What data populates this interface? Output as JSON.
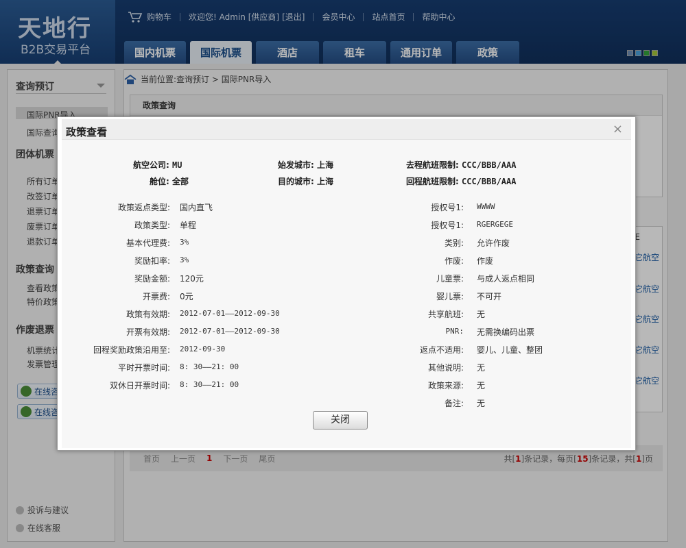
{
  "header": {
    "logo_main": "天地行",
    "logo_sub": "B2B交易平台",
    "top_links": [
      "购物车",
      "欢迎您! Admin [供应商]",
      "[退出]",
      "会员中心",
      "站点首页",
      "帮助中心"
    ],
    "tabs": [
      "国内机票",
      "国际机票",
      "酒店",
      "租车",
      "通用订单",
      "政策"
    ],
    "active_tab": "国际机票",
    "skin_colors": [
      "#6f8fb8",
      "#4aa3e0",
      "#34a53c",
      "#a6c83a"
    ]
  },
  "sidebar": {
    "section1": {
      "title": "查询预订",
      "items": [
        "国际PNR导入",
        "国际查询"
      ]
    },
    "section2": {
      "title": "团体机票",
      "items": [
        "所有订单",
        "改签订单",
        "退票订单",
        "废票订单",
        "退款订单"
      ]
    },
    "section3": {
      "title": "政策查询",
      "items": [
        "查看政策",
        "特价政策"
      ]
    },
    "section4": {
      "title": "作废退票",
      "items": [
        "机票统计",
        "发票管理"
      ]
    },
    "online_buttons": [
      "在线咨询",
      "在线咨询"
    ],
    "bottom": [
      "投诉与建议",
      "在线客服"
    ]
  },
  "breadcrumb": {
    "prefix": "当前位置:",
    "path": "查询预订 > 国际PNR导入"
  },
  "panel1": {
    "title": "政策查询"
  },
  "panel2": {
    "header_fragment": "E",
    "links": [
      "它航空",
      "它航空",
      "它航空",
      "它航空",
      "它航空"
    ]
  },
  "pager": {
    "first": "首页",
    "prev": "上一页",
    "current": "1",
    "next": "下一页",
    "last": "尾页",
    "info_a": "共[",
    "total": "1",
    "info_b": "]条记录，每页[",
    "per_page": "15",
    "info_c": "]条记录，共[",
    "pages": "1",
    "info_d": "]页"
  },
  "modal": {
    "title": "政策查看",
    "close_icon": "×",
    "header_fields": [
      {
        "label": "航空公司:",
        "value": "MU"
      },
      {
        "label": "舱位:",
        "value": "全部"
      },
      {
        "label": "始发城市:",
        "value": "上海"
      },
      {
        "label": "目的城市:",
        "value": "上海"
      },
      {
        "label": "去程航班限制:",
        "value": "CCC/BBB/AAA"
      },
      {
        "label": "回程航班限制:",
        "value": "CCC/BBB/AAA"
      }
    ],
    "left_fields": [
      {
        "label": "政策返点类型:",
        "value": "国内直飞"
      },
      {
        "label": "政策类型:",
        "value": "单程"
      },
      {
        "label": "基本代理费:",
        "value": "3%"
      },
      {
        "label": "奖励扣率:",
        "value": "3%"
      },
      {
        "label": "奖励金额:",
        "value": "120元"
      },
      {
        "label": "开票费:",
        "value": "0元"
      },
      {
        "label": "政策有效期:",
        "value": "2012-07-01——2012-09-30"
      },
      {
        "label": "开票有效期:",
        "value": "2012-07-01——2012-09-30"
      },
      {
        "label": "回程奖励政策沿用至:",
        "value": "2012-09-30"
      },
      {
        "label": "平时开票时间:",
        "value": "8: 30——21: 00"
      },
      {
        "label": "双休日开票时间:",
        "value": "8: 30——21: 00"
      }
    ],
    "right_fields": [
      {
        "label": "授权号1:",
        "value": "WWWW"
      },
      {
        "label": "授权号1:",
        "value": "RGERGEGE"
      },
      {
        "label": "类别:",
        "value": "允许作废"
      },
      {
        "label": "作废:",
        "value": "作废"
      },
      {
        "label": "儿童票:",
        "value": "与成人返点相同"
      },
      {
        "label": "婴儿票:",
        "value": "不可开"
      },
      {
        "label": "共享航班:",
        "value": "无"
      },
      {
        "label": "PNR:",
        "value": "无需换编码出票"
      },
      {
        "label": "返点不适用:",
        "value": "婴儿、儿童、整团"
      },
      {
        "label": "其他说明:",
        "value": "无"
      },
      {
        "label": "政策来源:",
        "value": "无"
      },
      {
        "label": "备注:",
        "value": "无"
      }
    ],
    "close_button": "关闭"
  }
}
